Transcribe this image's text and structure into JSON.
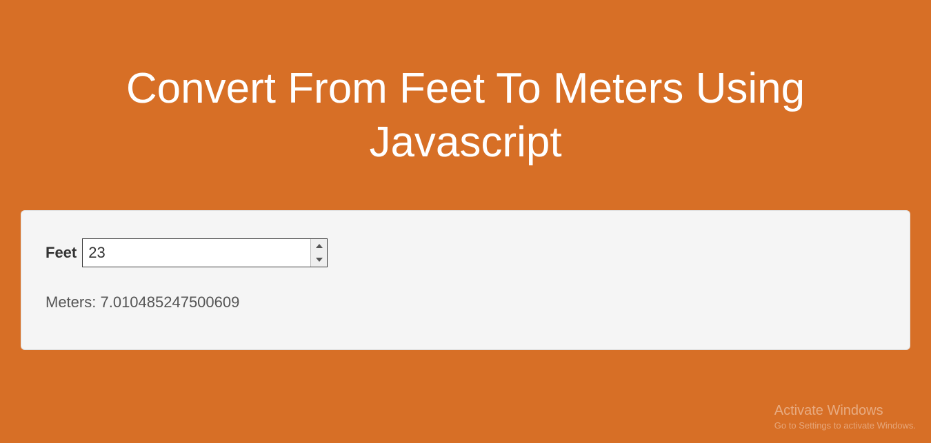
{
  "title": "Convert From Feet To Meters Using Javascript",
  "form": {
    "feet_label": "Feet",
    "feet_value": "23",
    "output_label": "Meters:",
    "output_value": "7.010485247500609"
  },
  "watermark": {
    "title": "Activate Windows",
    "subtitle": "Go to Settings to activate Windows."
  }
}
